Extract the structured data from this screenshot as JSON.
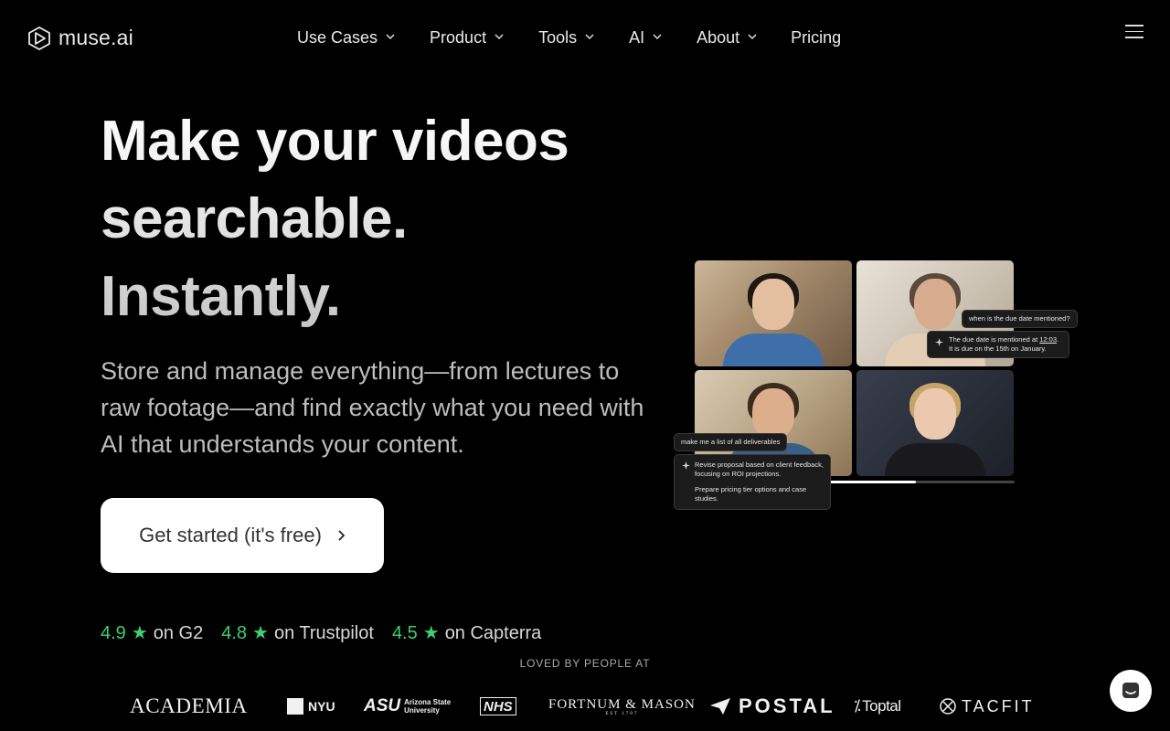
{
  "brand": {
    "name": "muse.ai"
  },
  "nav": {
    "items": [
      {
        "label": "Use Cases",
        "has_dropdown": true
      },
      {
        "label": "Product",
        "has_dropdown": true
      },
      {
        "label": "Tools",
        "has_dropdown": true
      },
      {
        "label": "AI",
        "has_dropdown": true
      },
      {
        "label": "About",
        "has_dropdown": true
      },
      {
        "label": "Pricing",
        "has_dropdown": false
      }
    ]
  },
  "hero": {
    "headline_lines": [
      "Make your videos",
      "searchable.",
      "Instantly."
    ],
    "subheadline": "Store and manage everything—from lectures to raw footage—and find exactly what you need with AI that understands your content.",
    "cta_label": "Get started (it's free)"
  },
  "ratings": [
    {
      "score": "4.9",
      "star": "★",
      "site": "on G2"
    },
    {
      "score": "4.8",
      "star": "★",
      "site": "on Trustpilot"
    },
    {
      "score": "4.5",
      "star": "★",
      "site": "on Capterra"
    }
  ],
  "loved_by": {
    "heading": "LOVED BY PEOPLE AT",
    "logos": {
      "academia": "ACADEMIA",
      "nyu": "NYU",
      "asu": "ASU",
      "asu_sub1": "Arizona State",
      "asu_sub2": "University",
      "nhs": "NHS",
      "fortnum": "FORTNUM & MASON",
      "fortnum_sub": "EST 1707",
      "postal": "POSTAL",
      "toptal": "Toptal",
      "tacfit": "TACFIT"
    }
  },
  "video_demo": {
    "progress": 0.69,
    "chat1_question": "when is the due date mentioned?",
    "chat1_answer_pre": "The due date is mentioned at ",
    "chat1_answer_time": "12:03",
    "chat1_answer_post": ". It is due on the 15th on January.",
    "chat2_question": "make me a list of all deliverables",
    "chat2_answer_1": "Revise proposal based on client feedback, focusing on ROI projections.",
    "chat2_answer_2": "Prepare pricing tier options and case studies."
  },
  "colors": {
    "background": "#000000",
    "rating_green": "#3fcf6f",
    "cta_bg": "#ffffff"
  },
  "icons": {
    "logo": "muse-play-hexagon-icon",
    "dropdown": "chevron-down-icon",
    "menu": "hamburger-icon",
    "cta_arrow": "chevron-right-icon",
    "ai": "sparkle-icon",
    "chat": "chat-icon"
  }
}
